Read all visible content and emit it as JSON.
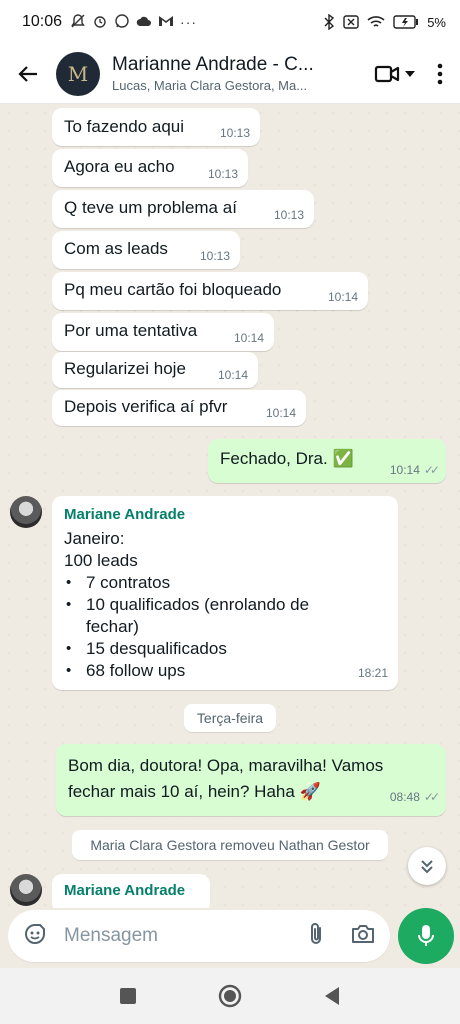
{
  "status_bar": {
    "time": "10:06",
    "battery": "5%"
  },
  "header": {
    "title": "Marianne Andrade - C...",
    "subtitle": "Lucas, Maria Clara Gestora, Ma...",
    "avatar_letter": "M",
    "icons": [
      "back-arrow-icon",
      "video-call-icon",
      "chevron-down-icon",
      "more-vertical-icon"
    ]
  },
  "messages_in_group": [
    {
      "text": "To fazendo aqui",
      "time": "10:13"
    },
    {
      "text": "Agora eu acho",
      "time": "10:13"
    },
    {
      "text": "Q teve um problema aí",
      "time": "10:13"
    },
    {
      "text": "Com as leads",
      "time": "10:13"
    },
    {
      "text": "Pq meu cartão foi bloqueado",
      "time": "10:14"
    },
    {
      "text": "Por uma tentativa",
      "time": "10:14"
    },
    {
      "text": "Regularizei hoje",
      "time": "10:14"
    },
    {
      "text": "Depois verifica aí pfvr",
      "time": "10:14"
    }
  ],
  "outgoing_1": {
    "text": "Fechado, Dra. ✅",
    "time": "10:14"
  },
  "incoming_report": {
    "sender": "Mariane Andrade",
    "line1": "Janeiro:",
    "line2": "100 leads",
    "items": [
      "7 contratos",
      "10 qualificados (enrolando de fechar)",
      "15 desqualificados",
      "68 follow ups"
    ],
    "time": "18:21"
  },
  "day_divider": "Terça-feira",
  "outgoing_2": {
    "text": "Bom dia, doutora! Opa, maravilha! Vamos fechar mais 10 aí, hein? Haha 🚀",
    "time": "08:48"
  },
  "system_message": "Maria Clara Gestora removeu Nathan Gestor",
  "incoming_last": {
    "sender": "Mariane Andrade"
  },
  "input": {
    "placeholder": "Mensagem"
  },
  "colors": {
    "accent_green": "#1daa61",
    "outgoing_bubble": "#d9fdd3",
    "sender_name": "#06806b",
    "chat_background": "#efeae2"
  }
}
